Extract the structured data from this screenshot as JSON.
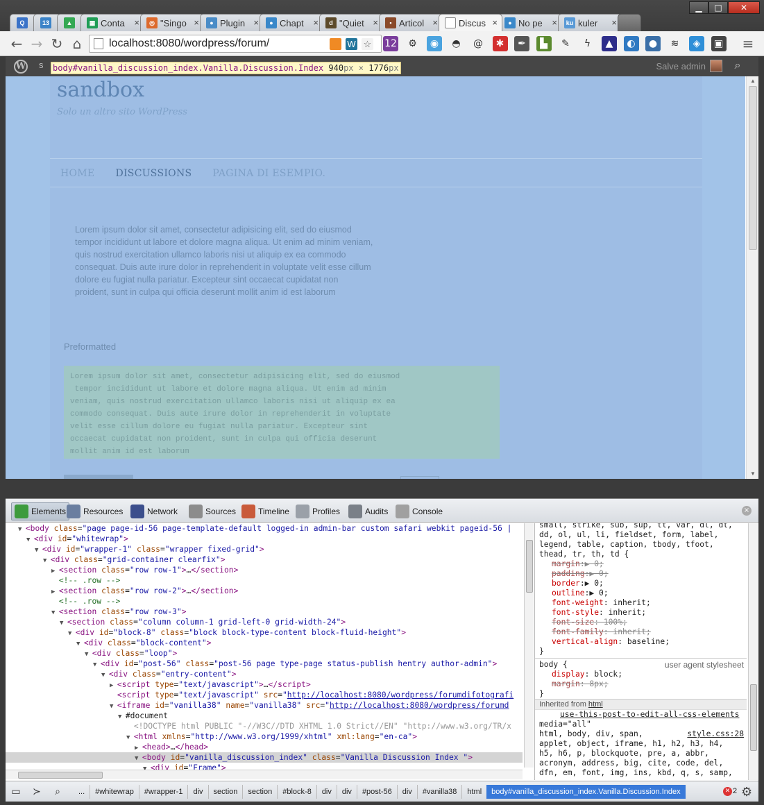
{
  "browser": {
    "tabs": [
      {
        "label": "",
        "icon": "q-icon",
        "color": "#3b73c8",
        "glyph": "Q",
        "width": "narrow"
      },
      {
        "label": "",
        "icon": "calendar-icon",
        "color": "#3b83c8",
        "glyph": "13",
        "width": "narrow"
      },
      {
        "label": "",
        "icon": "drive-icon",
        "color": "#34a853",
        "glyph": "▲",
        "width": "narrow"
      },
      {
        "label": "Conta",
        "icon": "sheets-icon",
        "color": "#1f9d55",
        "glyph": "▦",
        "width": "mid"
      },
      {
        "label": "\"Singo",
        "icon": "ubuntu-icon",
        "color": "#dd6a2c",
        "glyph": "◎",
        "width": "mid"
      },
      {
        "label": "Plugin",
        "icon": "wordpress-plugin-icon",
        "color": "#4a8cc7",
        "glyph": "●",
        "width": "mid"
      },
      {
        "label": "Chapt",
        "icon": "blog-icon",
        "color": "#3a88c9",
        "glyph": "●",
        "width": "mid"
      },
      {
        "label": "\"Quiet",
        "icon": "book-icon",
        "color": "#5c4a2a",
        "glyph": "d",
        "width": "mid"
      },
      {
        "label": "Articol",
        "icon": "article-icon",
        "color": "#8a4a2a",
        "glyph": "▪",
        "width": "mid"
      },
      {
        "label": "Discus",
        "icon": "page-icon",
        "color": "#ffffff",
        "glyph": "",
        "width": "mid",
        "active": true
      },
      {
        "label": "No pe",
        "icon": "blog2-icon",
        "color": "#3a88c9",
        "glyph": "●",
        "width": "mid"
      },
      {
        "label": "kuler",
        "icon": "kuler-icon",
        "color": "#5a9ad6",
        "glyph": "ku",
        "width": "mid"
      }
    ],
    "window_buttons": {
      "minimize": "▁",
      "maximize": "□",
      "close": "✕"
    },
    "nav": {
      "back": "←",
      "forward": "→",
      "reload": "↻",
      "home": "⌂"
    },
    "url": "localhost:8080/wordpress/forum/",
    "menu_icon": "≡",
    "extensions": [
      {
        "icon": "rss-feed-icon",
        "color": "#f08a24",
        "glyph": ""
      },
      {
        "icon": "wordpress-icon",
        "color": "#21759b",
        "glyph": "W"
      },
      {
        "icon": "star-icon",
        "color": "#f2f2f2",
        "glyph": "☆"
      },
      {
        "icon": "calendar-badge-icon",
        "color": "#7a3d9c",
        "glyph": "12"
      },
      {
        "icon": "gear-extension-icon",
        "color": "#f2f2f2",
        "glyph": "⚙"
      },
      {
        "icon": "hangouts-icon",
        "color": "#4aa3df",
        "glyph": "◉"
      },
      {
        "icon": "mask-icon",
        "color": "#f2f2f2",
        "glyph": "◓"
      },
      {
        "icon": "at-sign-icon",
        "color": "#f2f2f2",
        "glyph": "@"
      },
      {
        "icon": "lastpass-icon",
        "color": "#d32f2f",
        "glyph": "✱"
      },
      {
        "icon": "ink-pen-icon",
        "color": "#555555",
        "glyph": "✒"
      },
      {
        "icon": "evernote-icon",
        "color": "#5b8a2e",
        "glyph": "▙"
      },
      {
        "icon": "wrench-icon",
        "color": "#f2f2f2",
        "glyph": "✎"
      },
      {
        "icon": "lightning-icon",
        "color": "#f2f2f2",
        "glyph": "ϟ"
      },
      {
        "icon": "mountain-icon",
        "color": "#2d2d8a",
        "glyph": "▲"
      },
      {
        "icon": "pocket-icon",
        "color": "#2f79c2",
        "glyph": "◐"
      },
      {
        "icon": "circle-icon",
        "color": "#3a6fa8",
        "glyph": "●"
      },
      {
        "icon": "buffer-icon",
        "color": "#f2f2f2",
        "glyph": "≋"
      },
      {
        "icon": "puzzle-icon",
        "color": "#2f8fd8",
        "glyph": "◈"
      },
      {
        "icon": "clipper-icon",
        "color": "#444444",
        "glyph": "▣"
      }
    ]
  },
  "adminbar": {
    "site_name": "s",
    "greeting": "Salve admin",
    "inspector_tooltip": {
      "selector": "body#vanilla_discussion_index.Vanilla.Discussion.Index",
      "width": "940",
      "height": "1776",
      "unit": "px",
      "times": "×"
    }
  },
  "site": {
    "title": "sandbox",
    "tagline": "Solo un altro sito WordPress",
    "nav": [
      "HOME",
      "DISCUSSIONS",
      "PAGINA DI ESEMPIO."
    ],
    "lorem": "Lorem ipsum dolor sit amet, consectetur adipisicing elit, sed do eiusmod tempor incididunt ut labore et dolore magna aliqua. Ut enim ad minim veniam, quis nostrud exercitation ullamco laboris nisi ut aliquip ex ea commodo consequat. Duis aute irure dolor in reprehenderit in voluptate velit esse cillum dolore eu fugiat nulla pariatur. Excepteur sint occaecat cupidatat non proident, sunt in culpa qui officia deserunt mollit anim id est laborum",
    "preformatted_label": "Preformatted",
    "preformatted_text": "Lorem ipsum dolor sit amet, consectetur adipisicing elit, sed do eiusmod\n tempor incididunt ut labore et dolore magna aliqua. Ut enim ad minim\nveniam, quis nostrud exercitation ullamco laboris nisi ut aliquip ex ea\ncommodo consequat. Duis aute irure dolor in reprehenderit in voluptate\nvelit esse cillum dolore eu fugiat nulla pariatur. Excepteur sint\noccaecat cupidatat non proident, sunt in culpa qui officia deserunt\nmollit anim id est laborum"
  },
  "devtools": {
    "tabs": [
      {
        "label": "Elements",
        "icon": "elements-icon",
        "color": "#3d9b3d",
        "active": true
      },
      {
        "label": "Resources",
        "icon": "resources-icon",
        "color": "#6a7ea0"
      },
      {
        "label": "Network",
        "icon": "network-icon",
        "color": "#3b4e8c"
      },
      {
        "label": "Sources",
        "icon": "sources-icon",
        "color": "#8c8c8c"
      },
      {
        "label": "Timeline",
        "icon": "timeline-icon",
        "color": "#c95a3a"
      },
      {
        "label": "Profiles",
        "icon": "profiles-icon",
        "color": "#9aa0a8"
      },
      {
        "label": "Audits",
        "icon": "audits-icon",
        "color": "#7a8088"
      },
      {
        "label": "Console",
        "icon": "console-icon",
        "color": "#a0a0a0"
      }
    ],
    "close": "×",
    "dom_lines": [
      {
        "indent": 1,
        "tw": "▼",
        "html": "<span class='tag'>&lt;body</span> <span class='attr'>class</span>=<span class='val'>\"page page-id-56 page-template-default logged-in admin-bar custom safari webkit pageid-56 |</span>"
      },
      {
        "indent": 2,
        "tw": "▼",
        "html": "<span class='tag'>&lt;div</span> <span class='attr'>id</span>=<span class='val'>\"whitewrap\"</span><span class='tag'>&gt;</span>"
      },
      {
        "indent": 3,
        "tw": "▼",
        "html": "<span class='tag'>&lt;div</span> <span class='attr'>id</span>=<span class='val'>\"wrapper-1\"</span> <span class='attr'>class</span>=<span class='val'>\"wrapper fixed-grid\"</span><span class='tag'>&gt;</span>"
      },
      {
        "indent": 4,
        "tw": "▼",
        "html": "<span class='tag'>&lt;div</span> <span class='attr'>class</span>=<span class='val'>\"grid-container clearfix\"</span><span class='tag'>&gt;</span>"
      },
      {
        "indent": 5,
        "tw": "▶",
        "html": "<span class='tag'>&lt;section</span> <span class='attr'>class</span>=<span class='val'>\"row row-1\"</span><span class='tag'>&gt;</span>…<span class='tag'>&lt;/section&gt;</span>"
      },
      {
        "indent": 5,
        "tw": " ",
        "html": "<span class='cmt'>&lt;!-- .row --&gt;</span>"
      },
      {
        "indent": 5,
        "tw": "▶",
        "html": "<span class='tag'>&lt;section</span> <span class='attr'>class</span>=<span class='val'>\"row row-2\"</span><span class='tag'>&gt;</span>…<span class='tag'>&lt;/section&gt;</span>"
      },
      {
        "indent": 5,
        "tw": " ",
        "html": "<span class='cmt'>&lt;!-- .row --&gt;</span>"
      },
      {
        "indent": 5,
        "tw": "▼",
        "html": "<span class='tag'>&lt;section</span> <span class='attr'>class</span>=<span class='val'>\"row row-3\"</span><span class='tag'>&gt;</span>"
      },
      {
        "indent": 6,
        "tw": "▼",
        "html": "<span class='tag'>&lt;section</span> <span class='attr'>class</span>=<span class='val'>\"column column-1 grid-left-0 grid-width-24\"</span><span class='tag'>&gt;</span>"
      },
      {
        "indent": 7,
        "tw": "▼",
        "html": "<span class='tag'>&lt;div</span> <span class='attr'>id</span>=<span class='val'>\"block-8\"</span> <span class='attr'>class</span>=<span class='val'>\"block block-type-content block-fluid-height\"</span><span class='tag'>&gt;</span>"
      },
      {
        "indent": 8,
        "tw": "▼",
        "html": "<span class='tag'>&lt;div</span> <span class='attr'>class</span>=<span class='val'>\"block-content\"</span><span class='tag'>&gt;</span>"
      },
      {
        "indent": 9,
        "tw": "▼",
        "html": "<span class='tag'>&lt;div</span> <span class='attr'>class</span>=<span class='val'>\"loop\"</span><span class='tag'>&gt;</span>"
      },
      {
        "indent": 10,
        "tw": "▼",
        "html": "<span class='tag'>&lt;div</span> <span class='attr'>id</span>=<span class='val'>\"post-56\"</span> <span class='attr'>class</span>=<span class='val'>\"post-56 page type-page status-publish hentry author-admin\"</span><span class='tag'>&gt;</span>"
      },
      {
        "indent": 11,
        "tw": "▼",
        "html": "<span class='tag'>&lt;div</span> <span class='attr'>class</span>=<span class='val'>\"entry-content\"</span><span class='tag'>&gt;</span>"
      },
      {
        "indent": 12,
        "tw": "▶",
        "html": "<span class='tag'>&lt;script</span> <span class='attr'>type</span>=<span class='val'>\"text/javascript\"</span><span class='tag'>&gt;</span>…<span class='tag'>&lt;/script&gt;</span>"
      },
      {
        "indent": 12,
        "tw": " ",
        "html": "<span class='tag'>&lt;script</span> <span class='attr'>type</span>=<span class='val'>\"text/javascript\"</span> <span class='attr'>src</span>=<span class='val'>\"<span class='link'>http://localhost:8080/wordpress/forumdifotografi</span></span>"
      },
      {
        "indent": 12,
        "tw": "▼",
        "html": "<span class='tag'>&lt;iframe</span> <span class='attr'>id</span>=<span class='val'>\"vanilla38\"</span> <span class='attr'>name</span>=<span class='val'>\"vanilla38\"</span> <span class='attr'>src</span>=<span class='val'>\"<span class='link'>http://localhost:8080/wordpress/forumd</span></span>"
      },
      {
        "indent": 13,
        "tw": "▼",
        "html": "<span class='doc'>#document</span>"
      },
      {
        "indent": 14,
        "tw": " ",
        "html": "<span style='color:#999'>&lt;!DOCTYPE html PUBLIC \"-//W3C//DTD XHTML 1.0 Strict//EN\" \"http://www.w3.org/TR/x</span>"
      },
      {
        "indent": 14,
        "tw": "▼",
        "html": "<span class='tag'>&lt;html</span> <span class='attr'>xmlns</span>=<span class='val'>\"http://www.w3.org/1999/xhtml\"</span> <span class='attr'>xml:lang</span>=<span class='val'>\"en-ca\"</span><span class='tag'>&gt;</span>"
      },
      {
        "indent": 15,
        "tw": "▶",
        "html": "<span class='tag'>&lt;head&gt;</span>…<span class='tag'>&lt;/head&gt;</span>"
      },
      {
        "indent": 15,
        "tw": "▼",
        "html": "<span class='tag'>&lt;body</span> <span class='attr'>id</span>=<span class='val'>\"vanilla_discussion_index\"</span> <span class='attr'>class</span>=<span class='val'>\"Vanilla Discussion Index \"</span><span class='tag'>&gt;</span>",
        "selected": true
      },
      {
        "indent": 16,
        "tw": "▼",
        "html": "<span class='tag'>&lt;div</span> <span class='attr'>id</span>=<span class='val'>\"Frame\"</span><span class='tag'>&gt;</span>"
      }
    ],
    "styles": {
      "rule1_selector_tail": [
        "small, strike, sub, sup, tt, var, dl, dt,",
        "dd, ol, ul, li, fieldset, form, label,",
        "legend, table, caption, tbody, tfoot,",
        "thead, tr, th, td {"
      ],
      "rule1_props": [
        {
          "name": "margin",
          "value": "▶ 0;",
          "struck": true
        },
        {
          "name": "padding",
          "value": "▶ 0;",
          "struck": true
        },
        {
          "name": "border",
          "value": "▶ 0;",
          "struck": false
        },
        {
          "name": "outline",
          "value": "▶ 0;",
          "struck": false
        },
        {
          "name": "font-weight",
          "value": " inherit;",
          "struck": false
        },
        {
          "name": "font-style",
          "value": " inherit;",
          "struck": false
        },
        {
          "name": "font-size",
          "value": " 100%;",
          "struck": true
        },
        {
          "name": "font-family",
          "value": " inherit;",
          "struck": true
        },
        {
          "name": "vertical-align",
          "value": " baseline;",
          "struck": false
        }
      ],
      "close_brace": "}",
      "rule2_selector": "body {",
      "rule2_origin": "user agent stylesheet",
      "rule2_props": [
        {
          "name": "display",
          "value": " block;",
          "struck": false
        },
        {
          "name": "margin",
          "value": " 8px;",
          "struck": true
        }
      ],
      "inherited_label": "Inherited from",
      "inherited_from": "html",
      "media_link": "use-this-post-to-edit-all-css-elements",
      "media_line": "media=\"all\"",
      "rule3_file": "style.css:28",
      "rule3_selector": [
        "html, body, div, span,",
        "applet, object, iframe, h1, h2, h3, h4,",
        "h5, h6, p, blockquote, pre, a, abbr,",
        "acronym, address, big, cite, code, del,",
        "dfn, em, font, img, ins, kbd, q, s, samp,"
      ]
    },
    "statusbar": {
      "breadcrumbs": [
        "...",
        "#whitewrap",
        "#wrapper-1",
        "div",
        "section",
        "section",
        "#block-8",
        "div",
        "div",
        "#post-56",
        "div",
        "#vanilla38",
        "html",
        "body#vanilla_discussion_index.Vanilla.Discussion.Index"
      ],
      "error_count": "2",
      "error_glyph": "✕"
    }
  }
}
